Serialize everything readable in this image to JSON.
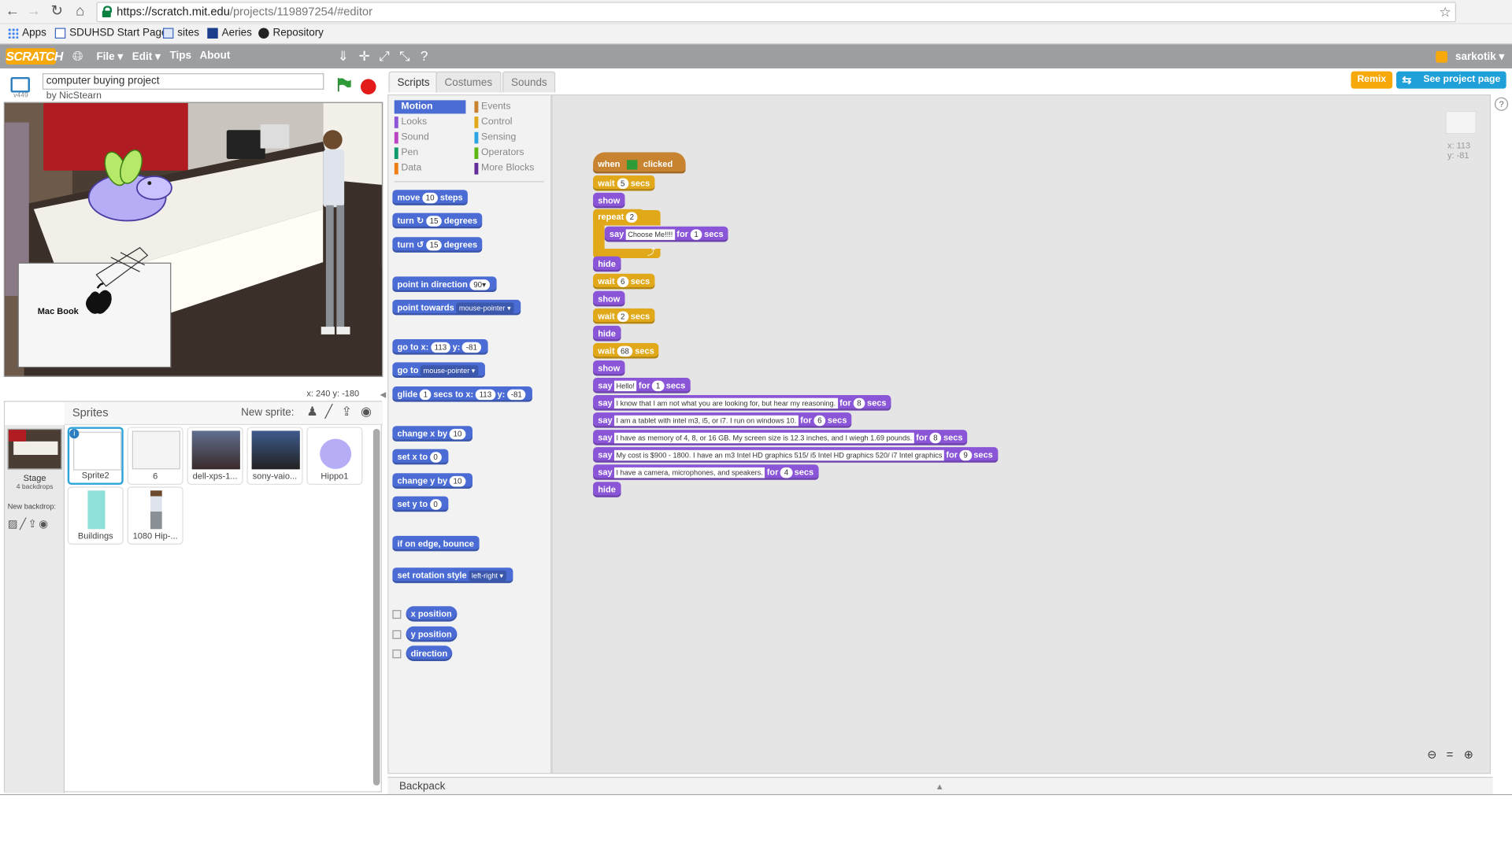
{
  "browser": {
    "url_host": "https://scratch.mit.edu",
    "url_path": "/projects/119897254/#editor",
    "bookmarks": [
      "Apps",
      "SDUHSD Start Page",
      "sites",
      "Aeries",
      "Repository"
    ]
  },
  "menubar": {
    "logo": "SCRATCH",
    "items": [
      "File ▾",
      "Edit ▾",
      "Tips",
      "About"
    ],
    "user": "sarkotik ▾"
  },
  "project": {
    "title": "computer buying project",
    "byline": "by NicStearn",
    "version": "v449",
    "remix_label": "Remix",
    "see_project_label": "See project page"
  },
  "stage": {
    "sprite_text": "Mac Book",
    "coords": "x: 240   y: -180"
  },
  "sprites": {
    "header": "Sprites",
    "new_sprite": "New sprite:",
    "stage_label": "Stage",
    "stage_backdrops": "4 backdrops",
    "new_backdrop": "New backdrop:",
    "items": [
      "Sprite2",
      "6",
      "dell-xps-1...",
      "sony-vaio...",
      "Hippo1",
      "Buildings",
      "1080 Hip-..."
    ]
  },
  "tabs": [
    "Scripts",
    "Costumes",
    "Sounds"
  ],
  "categories": {
    "left": [
      "Motion",
      "Looks",
      "Sound",
      "Pen",
      "Data"
    ],
    "right": [
      "Events",
      "Control",
      "Sensing",
      "Operators",
      "More Blocks"
    ]
  },
  "palette": {
    "move_pre": "move",
    "move_val": "10",
    "move_post": "steps",
    "turn_cw_pre": "turn ↻",
    "turn_val": "15",
    "turn_post": "degrees",
    "turn_ccw_pre": "turn ↺",
    "point_dir_pre": "point in direction",
    "point_dir_val": "90▾",
    "point_towards_pre": "point towards",
    "point_towards_val": "mouse-pointer ▾",
    "goto_xy_pre": "go to x:",
    "goto_x": "113",
    "goto_y_lbl": "y:",
    "goto_y": "-81",
    "goto_pre": "go to",
    "goto_val": "mouse-pointer ▾",
    "glide_pre": "glide",
    "glide_secs": "1",
    "glide_mid": "secs to x:",
    "glide_x": "113",
    "glide_y_lbl": "y:",
    "glide_y": "-81",
    "change_x_pre": "change x by",
    "change_x_val": "10",
    "set_x_pre": "set x to",
    "set_x_val": "0",
    "change_y_pre": "change y by",
    "change_y_val": "10",
    "set_y_pre": "set y to",
    "set_y_val": "0",
    "bounce": "if on edge, bounce",
    "rot_style_pre": "set rotation style",
    "rot_style_val": "left-right ▾",
    "reporters": [
      "x position",
      "y position",
      "direction"
    ]
  },
  "script": {
    "hat_when": "when",
    "hat_clicked": "clicked",
    "wait": "wait",
    "secs": "secs",
    "show": "show",
    "hide": "hide",
    "repeat": "repeat",
    "repeat_val": "2",
    "say": "say",
    "for": "for",
    "wait_vals": [
      "5",
      "6",
      "2",
      "68"
    ],
    "inner_say_text": "Choose Me!!!!",
    "inner_say_secs": "1",
    "says": [
      {
        "text": "Hello!",
        "secs": "1"
      },
      {
        "text": "I know that I am not what you are looking for, but hear my reasoning.",
        "secs": "8"
      },
      {
        "text": "I am a tablet with intel m3, i5, or i7. I run on windows 10.",
        "secs": "6"
      },
      {
        "text": "I have as memory of 4, 8, or 16 GB. My screen size is 12.3 inches, and I wiegh 1.69 pounds.",
        "secs": "8"
      },
      {
        "text": "My cost is $900 - 1800. I have an m3 Intel HD graphics 515/ i5 Intel HD graphics 520/ i7 Intel graphics",
        "secs": "9"
      },
      {
        "text": "I have a camera, microphones, and speakers.",
        "secs": "4"
      }
    ],
    "mouse_x": "x: 113",
    "mouse_y": "y: -81"
  },
  "backpack": "Backpack",
  "colors": {
    "motion": "#4a6cd4",
    "looks": "#8a55d7",
    "control": "#e1a91a",
    "events": "#c88330",
    "sound": "#bb42c3",
    "pen": "#0e9a6c",
    "data": "#ee7d16",
    "sensing": "#2ca5e2",
    "operators": "#5cb712",
    "more": "#632d99"
  }
}
